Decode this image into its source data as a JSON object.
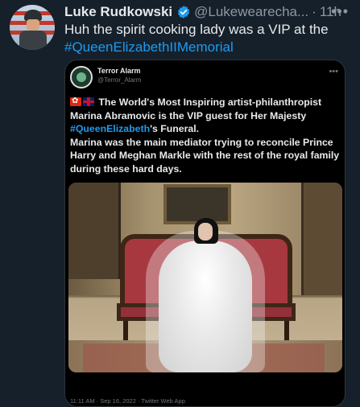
{
  "tweet": {
    "author_name": "Luke Rudkowski",
    "author_handle": "@Lukewearecha...",
    "separator": "·",
    "time": "11h",
    "more": "•••",
    "text_plain": "Huh the spirit cooking lady was a VIP at the",
    "hashtag": "#QueenElizabethIIMemorial"
  },
  "quoted": {
    "author_name": "Terror Alarm",
    "author_handle": "@Terror_Alarm",
    "more": "•••",
    "line1": "The World's Most Inspiring artist-philanthropist Marina Abramovic is the VIP guest for Her Majesty",
    "hashtag": "#QueenElizabeth",
    "line2": "'s Funeral.",
    "line3": "Marina was the main mediator trying to reconcile Prince Harry and Meghan Markle with the rest of the royal family during these hard days.",
    "footer": "11:11 AM · Sep 16, 2022 · Twitter Web App"
  },
  "colors": {
    "background": "#15202b",
    "link": "#1d9bf0",
    "verified": "#1d9bf0"
  },
  "icons": [
    "verified-badge-icon",
    "more-icon",
    "hong-kong-flag-icon",
    "uk-flag-icon"
  ]
}
